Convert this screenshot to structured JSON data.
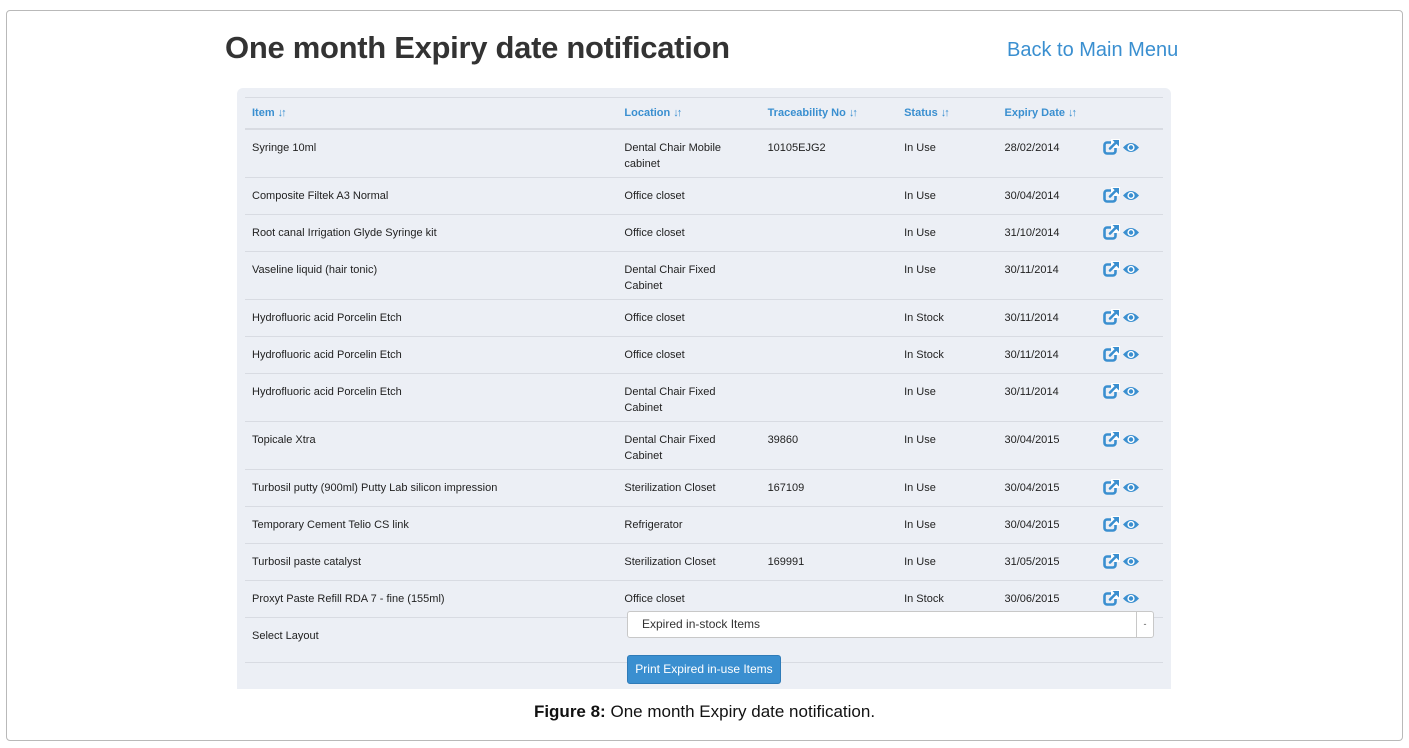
{
  "header": {
    "title": "One month Expiry date notification",
    "back_link": "Back to Main Menu"
  },
  "table": {
    "columns": {
      "item": "Item",
      "location": "Location",
      "traceability": "Traceability No",
      "status": "Status",
      "expiry": "Expiry Date"
    },
    "sort_glyph": "↓↑",
    "rows": [
      {
        "item": "Syringe 10ml",
        "location": "Dental Chair Mobile cabinet",
        "traceability": "10105EJG2",
        "status": "In Use",
        "expiry": "28/02/2014"
      },
      {
        "item": "Composite Filtek A3 Normal",
        "location": "Office closet",
        "traceability": "",
        "status": "In Use",
        "expiry": "30/04/2014"
      },
      {
        "item": "Root canal Irrigation Glyde Syringe kit",
        "location": "Office closet",
        "traceability": "",
        "status": "In Use",
        "expiry": "31/10/2014"
      },
      {
        "item": "Vaseline liquid (hair tonic)",
        "location": "Dental Chair Fixed Cabinet",
        "traceability": "",
        "status": "In Use",
        "expiry": "30/11/2014"
      },
      {
        "item": "Hydrofluoric acid Porcelin Etch",
        "location": "Office closet",
        "traceability": "",
        "status": "In Stock",
        "expiry": "30/11/2014"
      },
      {
        "item": "Hydrofluoric acid Porcelin Etch",
        "location": "Office closet",
        "traceability": "",
        "status": "In Stock",
        "expiry": "30/11/2014"
      },
      {
        "item": "Hydrofluoric acid Porcelin Etch",
        "location": "Dental Chair Fixed Cabinet",
        "traceability": "",
        "status": "In Use",
        "expiry": "30/11/2014"
      },
      {
        "item": "Topicale Xtra",
        "location": "Dental Chair Fixed Cabinet",
        "traceability": "39860",
        "status": "In Use",
        "expiry": "30/04/2015"
      },
      {
        "item": "Turbosil putty (900ml) Putty Lab silicon impression",
        "location": "Sterilization Closet",
        "traceability": "167109",
        "status": "In Use",
        "expiry": "30/04/2015"
      },
      {
        "item": "Temporary Cement Telio CS link",
        "location": "Refrigerator",
        "traceability": "",
        "status": "In Use",
        "expiry": "30/04/2015"
      },
      {
        "item": "Turbosil paste catalyst",
        "location": "Sterilization Closet",
        "traceability": "169991",
        "status": "In Use",
        "expiry": "31/05/2015"
      },
      {
        "item": "Proxyt Paste Refill RDA 7 - fine (155ml)",
        "location": "Office closet",
        "traceability": "",
        "status": "In Stock",
        "expiry": "30/06/2015"
      }
    ],
    "row_icons": [
      "edit-external-icon",
      "eye-icon"
    ]
  },
  "layout": {
    "label": "Select Layout",
    "selected": "Expired in-stock Items",
    "arrow": "-"
  },
  "print_button": "Print Expired in-use Items",
  "caption": {
    "label": "Figure 8:",
    "text": "One month Expiry date notification."
  },
  "colors": {
    "accent": "#3a8fd0",
    "panel_bg": "#eceff5",
    "title": "#333333"
  }
}
